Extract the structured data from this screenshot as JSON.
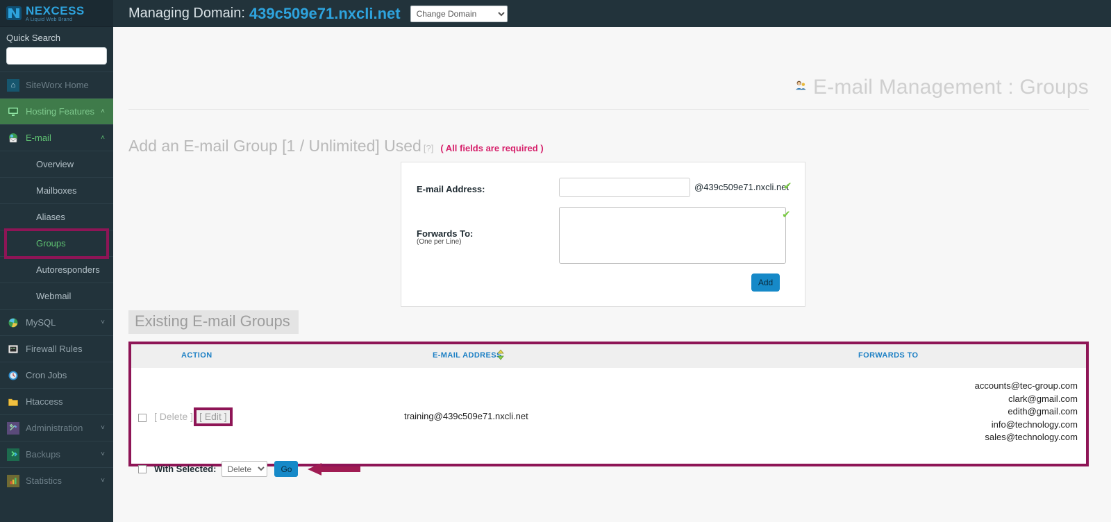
{
  "brand": {
    "name": "NEXCESS",
    "tagline": "A Liquid Web Brand",
    "trademark": "™",
    "logo_color": "#2ea3dd"
  },
  "sidebar": {
    "quick_search": {
      "label": "Quick Search",
      "value": "",
      "placeholder": ""
    },
    "items": [
      {
        "label": "SiteWorx Home",
        "icon": "home-icon",
        "caret": "",
        "state": "dim"
      },
      {
        "label": "Hosting Features",
        "icon": "monitor-icon",
        "caret": "˄",
        "state": "active-green"
      },
      {
        "label": "E-mail",
        "icon": "email-globe-icon",
        "caret": "˄",
        "state": "expanded-green"
      },
      {
        "label": "MySQL",
        "icon": "database-icon",
        "caret": "˅",
        "state": "normal"
      },
      {
        "label": "Firewall Rules",
        "icon": "firewall-icon",
        "caret": "",
        "state": "normal"
      },
      {
        "label": "Cron Jobs",
        "icon": "clock-icon",
        "caret": "",
        "state": "normal"
      },
      {
        "label": "Htaccess",
        "icon": "folder-icon",
        "caret": "",
        "state": "normal"
      },
      {
        "label": "Administration",
        "icon": "tools-icon",
        "caret": "˅",
        "state": "dim"
      },
      {
        "label": "Backups",
        "icon": "backup-icon",
        "caret": "˅",
        "state": "dim"
      },
      {
        "label": "Statistics",
        "icon": "chart-icon",
        "caret": "˅",
        "state": "dim"
      }
    ],
    "email_subitems": [
      {
        "label": "Overview",
        "active": false
      },
      {
        "label": "Mailboxes",
        "active": false
      },
      {
        "label": "Aliases",
        "active": false
      },
      {
        "label": "Groups",
        "active": true
      },
      {
        "label": "Autoresponders",
        "active": false
      },
      {
        "label": "Webmail",
        "active": false
      }
    ]
  },
  "topbar": {
    "managing_label": "Managing Domain:",
    "domain": "439c509e71.nxcli.net",
    "change_domain_option": "Change Domain"
  },
  "page": {
    "title": "E-mail Management : Groups",
    "title_icon": "user-manager-icon"
  },
  "add_group": {
    "heading": "Add an E-mail Group [1 / Unlimited] Used",
    "help_marker": "[?]",
    "required_note": "( All fields are required )",
    "email_label": "E-mail Address:",
    "email_value": "",
    "email_placeholder": "",
    "email_suffix": "@439c509e71.nxcli.net",
    "email_valid_icon": "✔",
    "forwards_label": "Forwards To:",
    "forwards_sub_label": "(One per Line)",
    "forwards_value": "",
    "forwards_placeholder": "",
    "forwards_valid_icon": "✔",
    "add_button_label": "Add"
  },
  "existing": {
    "heading": "Existing E-mail Groups",
    "columns": {
      "action": "ACTION",
      "email_address": "E-MAIL ADDRESS",
      "forwards_to": "FORWARDS TO"
    },
    "sort_icon": "sort-updown-icon",
    "rows": [
      {
        "delete_label": "[ Delete ]",
        "edit_label": "[ Edit ]",
        "email": "training@439c509e71.nxcli.net",
        "forwards": [
          "accounts@tec-group.com",
          "clark@gmail.com",
          "edith@gmail.com",
          "info@technology.com",
          "sales@technology.com"
        ]
      }
    ],
    "bulk": {
      "label": "With Selected:",
      "selected_option": "Delete",
      "go_label": "Go"
    }
  },
  "annotations": {
    "highlight_color": "#8e1556",
    "arrow_color": "#a01c53"
  }
}
